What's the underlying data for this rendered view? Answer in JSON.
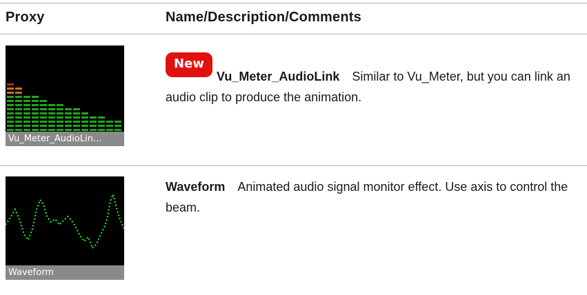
{
  "table": {
    "headers": {
      "proxy": "Proxy",
      "description": "Name/Description/Comments"
    },
    "rows": [
      {
        "badge": "New",
        "proxy_caption": "Vu_Meter_AudioLin...",
        "name": "Vu_Meter_AudioLink",
        "description": "Similar to Vu_Meter, but you can link an audio clip to produce the animation."
      },
      {
        "proxy_caption": "Waveform",
        "name": "Waveform",
        "description": "Animated audio signal monitor effect. Use axis to control the beam."
      }
    ]
  },
  "colors": {
    "badge_red": "#e0120f",
    "meter_green": "#1fa81f",
    "meter_orange": "#c8781e",
    "meter_red": "#c81e1e",
    "wave_green": "#2fe02f",
    "rule_gray": "#b5b5b5"
  }
}
